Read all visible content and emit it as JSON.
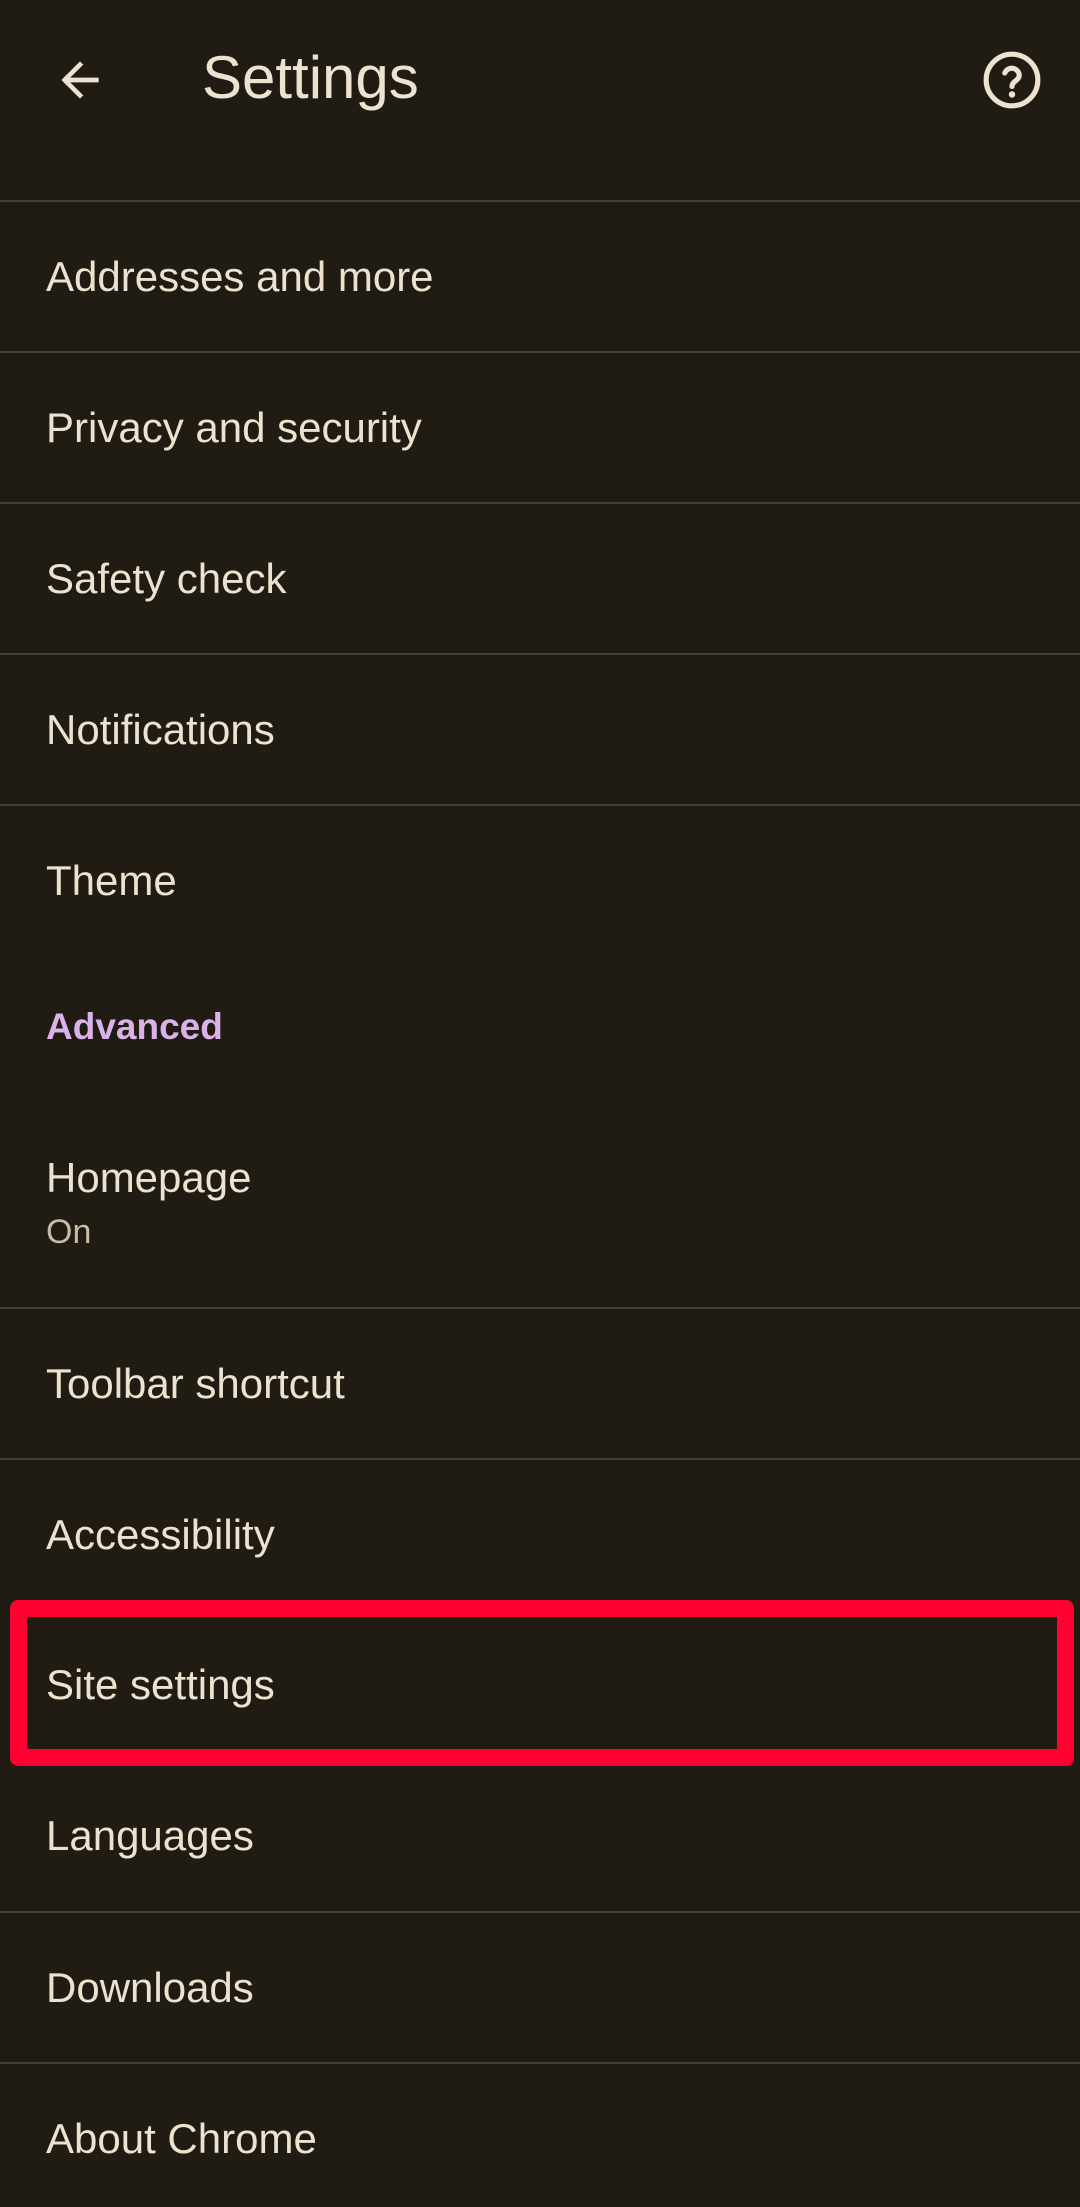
{
  "appbar": {
    "back_icon": "arrow-back-icon",
    "title": "Settings",
    "help_icon": "help-circle-icon"
  },
  "items": {
    "addresses": {
      "label": "Addresses and more"
    },
    "privacy": {
      "label": "Privacy and security"
    },
    "safety_check": {
      "label": "Safety check"
    },
    "notifications": {
      "label": "Notifications"
    },
    "theme": {
      "label": "Theme"
    },
    "advanced_header": {
      "label": "Advanced"
    },
    "homepage": {
      "label": "Homepage",
      "summary": "On"
    },
    "toolbar_shortcut": {
      "label": "Toolbar shortcut"
    },
    "accessibility": {
      "label": "Accessibility"
    },
    "site_settings": {
      "label": "Site settings"
    },
    "languages": {
      "label": "Languages"
    },
    "downloads": {
      "label": "Downloads"
    },
    "about_chrome": {
      "label": "About Chrome"
    }
  },
  "colors": {
    "background": "#201c13",
    "text": "#ece2cf",
    "secondary_text": "#c7bca5",
    "divider": "#47402f",
    "section_header": "#dab2e8",
    "highlight": "#ff0030"
  }
}
